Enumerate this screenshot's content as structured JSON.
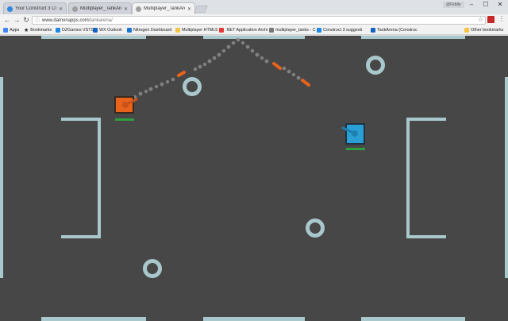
{
  "browser": {
    "tabs": [
      {
        "title": "Your Construct 3 Creatio",
        "active": false,
        "color": "#2e86de"
      },
      {
        "title": "Multiplayer_TankArena",
        "active": false,
        "color": "#9e9e9e"
      },
      {
        "title": "Multiplayer_TankArena",
        "active": true,
        "color": "#9e9e9e"
      }
    ],
    "profile_label": "@Fiddle",
    "address": {
      "host": "www.damonapps.com",
      "path": "/tankarena/"
    },
    "bookmarks": [
      {
        "label": "Apps",
        "color": "#4285f4"
      },
      {
        "label": "Bookmarks",
        "color": "#555555"
      },
      {
        "label": "DZGames VSTS",
        "color": "#1e88e5"
      },
      {
        "label": "WX Outlook",
        "color": "#1565c0"
      },
      {
        "label": "Nitrogen Dashboard",
        "color": "#1976d2"
      },
      {
        "label": "Multiplayer HTML5",
        "color": "#f6c343"
      },
      {
        "label": ".NET Application Archi",
        "color": "#e53935"
      },
      {
        "label": "multiplayer_tanks - C",
        "color": "#777777"
      },
      {
        "label": "Construct 3 suggesti",
        "color": "#1e88e5"
      },
      {
        "label": "TankArena (Construc",
        "color": "#1565c0"
      }
    ],
    "other_bookmarks": "Other bookmarks"
  },
  "game": {
    "background_color": "#474747",
    "wall_color": "#a9c8cc",
    "tanks": [
      {
        "team": "orange",
        "color": "#e8641c",
        "health": 1.0,
        "health_color": "#2e9e3e"
      },
      {
        "team": "blue",
        "color": "#2a9fd6",
        "health": 1.0,
        "health_color": "#2e9e3e"
      }
    ],
    "projectile_color": "#e8641c",
    "smoke_color": "#8a8a8a"
  }
}
